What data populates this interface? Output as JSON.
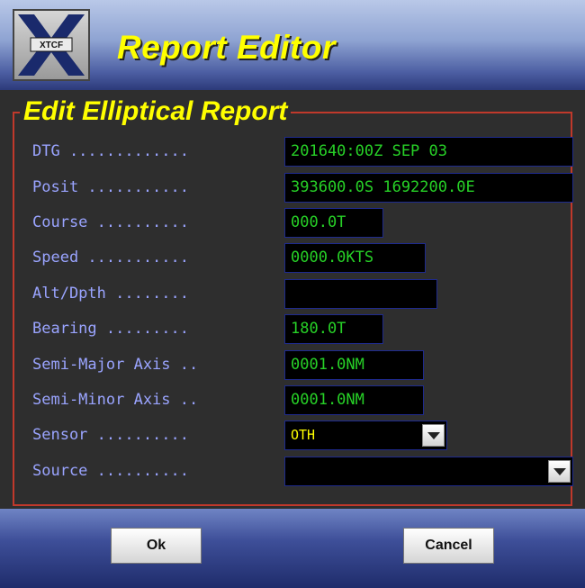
{
  "header": {
    "title": "Report Editor",
    "logo": {
      "text": "XTCF",
      "top_text": "",
      "bottom_text": ""
    }
  },
  "panel": {
    "title": "Edit Elliptical Report"
  },
  "fields": [
    {
      "label": "DTG .............",
      "value": "201640:00Z SEP 03"
    },
    {
      "label": "Posit ...........",
      "value": "393600.0S 1692200.0E"
    },
    {
      "label": "Course ..........",
      "value": "000.0T"
    },
    {
      "label": "Speed ...........",
      "value": "0000.0KTS"
    },
    {
      "label": "Alt/Dpth ........",
      "value": ""
    },
    {
      "label": "Bearing .........",
      "value": "180.0T"
    },
    {
      "label": "Semi-Major Axis ..",
      "value": "0001.0NM"
    },
    {
      "label": "Semi-Minor Axis ..",
      "value": "0001.0NM"
    },
    {
      "label": "Sensor ..........",
      "value": "OTH"
    },
    {
      "label": "Source ..........",
      "value": ""
    }
  ],
  "buttons": {
    "ok": "Ok",
    "cancel": "Cancel"
  },
  "colors": {
    "title": "#ffff00",
    "label": "#9aa4ff",
    "value": "#27d127",
    "panel_border": "#c0392b",
    "background": "#2e2e2e"
  }
}
